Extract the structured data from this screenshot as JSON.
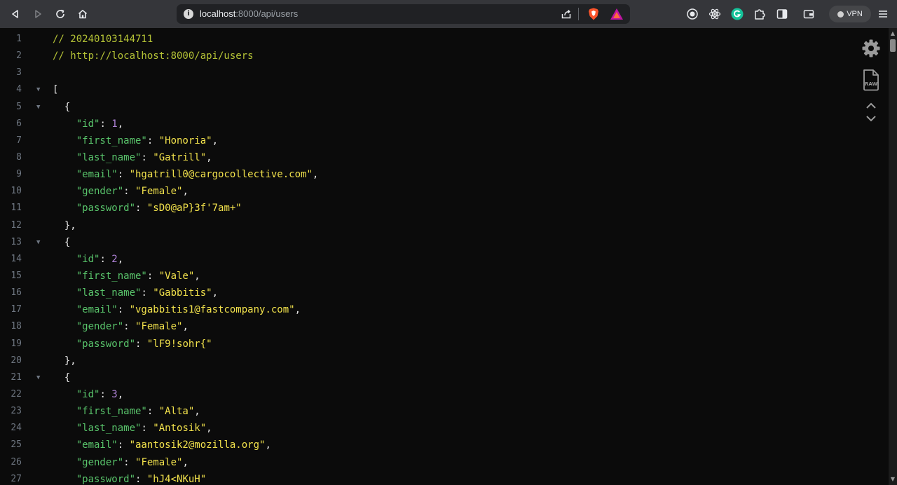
{
  "browser": {
    "url_host": "localhost",
    "url_rest": ":8000/api/users",
    "vpn_label": "VPN",
    "info_glyph": "i"
  },
  "icons": {
    "back": "back-arrow-icon",
    "forward": "forward-arrow-icon",
    "reload": "reload-icon",
    "home": "home-icon",
    "share": "share-icon",
    "brave": "brave-shield-icon",
    "rewards": "brave-rewards-icon",
    "ext1": "target-extension-icon",
    "ext2": "react-devtools-icon",
    "ext3": "grammarly-icon",
    "ext4": "puzzle-extensions-icon",
    "sidebar": "sidebar-toggle-icon",
    "wallet": "wallet-icon",
    "menu": "hamburger-menu-icon",
    "settings": "gear-icon",
    "raw": "raw-file-icon",
    "raw_label": "RAW",
    "collapse_up": "chevron-up-icon",
    "collapse_down": "chevron-down-icon"
  },
  "colors": {
    "comment": "#b4c236",
    "key": "#59c46b",
    "string": "#f2e24c",
    "number": "#b083d8",
    "punctuation": "#e6e6e6",
    "line_number": "#6e7681",
    "background": "#0b0b0b",
    "toolbar": "#35363a"
  },
  "lines": [
    {
      "n": "1",
      "fold": false,
      "parts": [
        {
          "t": "comment",
          "v": "// 20240103144711"
        }
      ]
    },
    {
      "n": "2",
      "fold": false,
      "parts": [
        {
          "t": "comment",
          "v": "// http://localhost:8000/api/users"
        }
      ]
    },
    {
      "n": "3",
      "fold": false,
      "parts": []
    },
    {
      "n": "4",
      "fold": true,
      "parts": [
        {
          "t": "punct",
          "v": "["
        }
      ]
    },
    {
      "n": "5",
      "fold": true,
      "parts": [
        {
          "t": "punct",
          "v": "  {"
        }
      ]
    },
    {
      "n": "6",
      "fold": false,
      "parts": [
        {
          "t": "key",
          "v": "    \"id\""
        },
        {
          "t": "punct",
          "v": ": "
        },
        {
          "t": "num",
          "v": "1"
        },
        {
          "t": "punct",
          "v": ","
        }
      ]
    },
    {
      "n": "7",
      "fold": false,
      "parts": [
        {
          "t": "key",
          "v": "    \"first_name\""
        },
        {
          "t": "punct",
          "v": ": "
        },
        {
          "t": "str",
          "v": "\"Honoria\""
        },
        {
          "t": "punct",
          "v": ","
        }
      ]
    },
    {
      "n": "8",
      "fold": false,
      "parts": [
        {
          "t": "key",
          "v": "    \"last_name\""
        },
        {
          "t": "punct",
          "v": ": "
        },
        {
          "t": "str",
          "v": "\"Gatrill\""
        },
        {
          "t": "punct",
          "v": ","
        }
      ]
    },
    {
      "n": "9",
      "fold": false,
      "parts": [
        {
          "t": "key",
          "v": "    \"email\""
        },
        {
          "t": "punct",
          "v": ": "
        },
        {
          "t": "str",
          "v": "\"hgatrill0@cargocollective.com\""
        },
        {
          "t": "punct",
          "v": ","
        }
      ]
    },
    {
      "n": "10",
      "fold": false,
      "parts": [
        {
          "t": "key",
          "v": "    \"gender\""
        },
        {
          "t": "punct",
          "v": ": "
        },
        {
          "t": "str",
          "v": "\"Female\""
        },
        {
          "t": "punct",
          "v": ","
        }
      ]
    },
    {
      "n": "11",
      "fold": false,
      "parts": [
        {
          "t": "key",
          "v": "    \"password\""
        },
        {
          "t": "punct",
          "v": ": "
        },
        {
          "t": "str",
          "v": "\"sD0@aP}3f'7am+\""
        }
      ]
    },
    {
      "n": "12",
      "fold": false,
      "parts": [
        {
          "t": "punct",
          "v": "  },"
        }
      ]
    },
    {
      "n": "13",
      "fold": true,
      "parts": [
        {
          "t": "punct",
          "v": "  {"
        }
      ]
    },
    {
      "n": "14",
      "fold": false,
      "parts": [
        {
          "t": "key",
          "v": "    \"id\""
        },
        {
          "t": "punct",
          "v": ": "
        },
        {
          "t": "num",
          "v": "2"
        },
        {
          "t": "punct",
          "v": ","
        }
      ]
    },
    {
      "n": "15",
      "fold": false,
      "parts": [
        {
          "t": "key",
          "v": "    \"first_name\""
        },
        {
          "t": "punct",
          "v": ": "
        },
        {
          "t": "str",
          "v": "\"Vale\""
        },
        {
          "t": "punct",
          "v": ","
        }
      ]
    },
    {
      "n": "16",
      "fold": false,
      "parts": [
        {
          "t": "key",
          "v": "    \"last_name\""
        },
        {
          "t": "punct",
          "v": ": "
        },
        {
          "t": "str",
          "v": "\"Gabbitis\""
        },
        {
          "t": "punct",
          "v": ","
        }
      ]
    },
    {
      "n": "17",
      "fold": false,
      "parts": [
        {
          "t": "key",
          "v": "    \"email\""
        },
        {
          "t": "punct",
          "v": ": "
        },
        {
          "t": "str",
          "v": "\"vgabbitis1@fastcompany.com\""
        },
        {
          "t": "punct",
          "v": ","
        }
      ]
    },
    {
      "n": "18",
      "fold": false,
      "parts": [
        {
          "t": "key",
          "v": "    \"gender\""
        },
        {
          "t": "punct",
          "v": ": "
        },
        {
          "t": "str",
          "v": "\"Female\""
        },
        {
          "t": "punct",
          "v": ","
        }
      ]
    },
    {
      "n": "19",
      "fold": false,
      "parts": [
        {
          "t": "key",
          "v": "    \"password\""
        },
        {
          "t": "punct",
          "v": ": "
        },
        {
          "t": "str",
          "v": "\"lF9!sohr{\""
        }
      ]
    },
    {
      "n": "20",
      "fold": false,
      "parts": [
        {
          "t": "punct",
          "v": "  },"
        }
      ]
    },
    {
      "n": "21",
      "fold": true,
      "parts": [
        {
          "t": "punct",
          "v": "  {"
        }
      ]
    },
    {
      "n": "22",
      "fold": false,
      "parts": [
        {
          "t": "key",
          "v": "    \"id\""
        },
        {
          "t": "punct",
          "v": ": "
        },
        {
          "t": "num",
          "v": "3"
        },
        {
          "t": "punct",
          "v": ","
        }
      ]
    },
    {
      "n": "23",
      "fold": false,
      "parts": [
        {
          "t": "key",
          "v": "    \"first_name\""
        },
        {
          "t": "punct",
          "v": ": "
        },
        {
          "t": "str",
          "v": "\"Alta\""
        },
        {
          "t": "punct",
          "v": ","
        }
      ]
    },
    {
      "n": "24",
      "fold": false,
      "parts": [
        {
          "t": "key",
          "v": "    \"last_name\""
        },
        {
          "t": "punct",
          "v": ": "
        },
        {
          "t": "str",
          "v": "\"Antosik\""
        },
        {
          "t": "punct",
          "v": ","
        }
      ]
    },
    {
      "n": "25",
      "fold": false,
      "parts": [
        {
          "t": "key",
          "v": "    \"email\""
        },
        {
          "t": "punct",
          "v": ": "
        },
        {
          "t": "str",
          "v": "\"aantosik2@mozilla.org\""
        },
        {
          "t": "punct",
          "v": ","
        }
      ]
    },
    {
      "n": "26",
      "fold": false,
      "parts": [
        {
          "t": "key",
          "v": "    \"gender\""
        },
        {
          "t": "punct",
          "v": ": "
        },
        {
          "t": "str",
          "v": "\"Female\""
        },
        {
          "t": "punct",
          "v": ","
        }
      ]
    },
    {
      "n": "27",
      "fold": false,
      "parts": [
        {
          "t": "key",
          "v": "    \"password\""
        },
        {
          "t": "punct",
          "v": ": "
        },
        {
          "t": "str",
          "v": "\"hJ4<NKuH\""
        }
      ]
    }
  ]
}
